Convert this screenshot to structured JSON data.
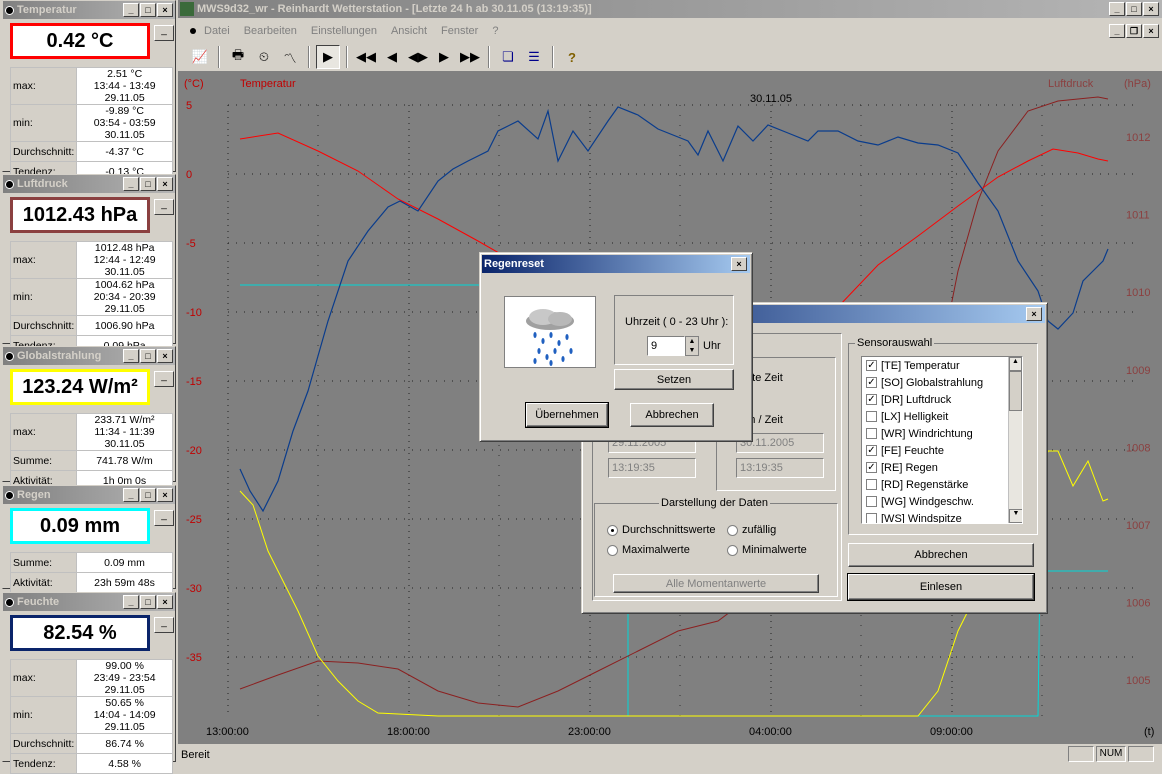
{
  "sensors": [
    {
      "title": "Temperatur",
      "value": "0.42 °C",
      "border": "#ff0000",
      "top": 0,
      "height": 172,
      "rows": [
        [
          "max:",
          "2.51 °C",
          "13:44 - 13:49  29.11.05"
        ],
        [
          "min:",
          "-9.89 °C",
          "03:54 - 03:59  30.11.05"
        ],
        [
          "Durchschnitt:",
          "-4.37 °C",
          ""
        ],
        [
          "Tendenz:",
          "-0.13 °C",
          ""
        ]
      ]
    },
    {
      "title": "Luftdruck",
      "value": "1012.43 hPa",
      "border": "#8b4040",
      "top": 174,
      "height": 170,
      "rows": [
        [
          "max:",
          "1012.48 hPa",
          "12:44 - 12:49  30.11.05"
        ],
        [
          "min:",
          "1004.62 hPa",
          "20:34 - 20:39  29.11.05"
        ],
        [
          "Durchschnitt:",
          "1006.90 hPa",
          ""
        ],
        [
          "Tendenz:",
          "0.09 hPa",
          ""
        ]
      ]
    },
    {
      "title": "Globalstrahlung",
      "value": "123.24 W/m²",
      "border": "#ffff00",
      "top": 346,
      "height": 136,
      "rows": [
        [
          "max:",
          "233.71 W/m²",
          "11:34 - 11:39  30.11.05"
        ],
        [
          "Summe:",
          "741.78 W/m",
          ""
        ],
        [
          "Aktivität:",
          "1h 0m 0s",
          ""
        ]
      ]
    },
    {
      "title": "Regen",
      "value": "0.09 mm",
      "border": "#00ffff",
      "top": 485,
      "height": 104,
      "rows": [
        [
          "Summe:",
          "0.09 mm",
          ""
        ],
        [
          "Aktivität:",
          "23h 59m 48s",
          ""
        ]
      ]
    },
    {
      "title": "Feuchte",
      "value": "82.54 %",
      "border": "#0a246a",
      "top": 592,
      "height": 170,
      "rows": [
        [
          "max:",
          "99.00 %",
          "23:49 - 23:54  29.11.05"
        ],
        [
          "min:",
          "50.65 %",
          "14:04 - 14:09  29.11.05"
        ],
        [
          "Durchschnitt:",
          "86.74 %",
          ""
        ],
        [
          "Tendenz:",
          "4.58 %",
          ""
        ]
      ]
    }
  ],
  "main": {
    "title": "MWS9d32_wr - Reinhardt Wetterstation - [Letzte 24 h ab 30.11.05 (13:19:35)]",
    "menu": [
      "Datei",
      "Bearbeiten",
      "Einstellungen",
      "Ansicht",
      "Fenster",
      "?"
    ]
  },
  "chart": {
    "left_unit": "(°C)",
    "left_label": "Temperatur",
    "right_unit": "(hPa)",
    "right_label": "Luftdruck",
    "date_label": "30.11.05",
    "x_unit": "(t)",
    "y_ticks": [
      "5",
      "0",
      "-5",
      "-10",
      "-15",
      "-20",
      "-25",
      "-30",
      "-35"
    ],
    "r_ticks": [
      "1012",
      "1011",
      "1010",
      "1009",
      "1008",
      "1007",
      "1006",
      "1005"
    ],
    "x_ticks": [
      "13:00:00",
      "18:00:00",
      "23:00:00",
      "04:00:00",
      "09:00:00"
    ]
  },
  "status": {
    "text": "Bereit",
    "num": "NUM"
  },
  "regen_dialog": {
    "title": "Regenreset",
    "time_label": "Uhrzeit ( 0 - 23 Uhr ):",
    "hour_value": "9",
    "hour_unit": "Uhr",
    "set_button": "Setzen",
    "ok_button": "Übernehmen",
    "cancel_button": "Abbrechen"
  },
  "data_dialog": {
    "latest_time": "ktuellste Zeit",
    "date_time": "Datum / Zeit",
    "date_from": "29.11.2005",
    "time_from": "13:19:35",
    "date_to": "30.11.2005",
    "time_to": "13:19:35",
    "display_group": "Darstellung der Daten",
    "radios": [
      "Durchschnittswerte",
      "zufällig",
      "Maximalwerte",
      "Minimalwerte"
    ],
    "moment_button": "Alle Momentanwerte",
    "sensor_group": "Sensorauswahl",
    "sensors": [
      {
        "label": "[TE] Temperatur",
        "checked": true
      },
      {
        "label": "[SO] Globalstrahlung",
        "checked": true
      },
      {
        "label": "[DR] Luftdruck",
        "checked": true
      },
      {
        "label": "[LX] Helligkeit",
        "checked": false
      },
      {
        "label": "[WR] Windrichtung",
        "checked": false
      },
      {
        "label": "[FE] Feuchte",
        "checked": true
      },
      {
        "label": "[RE] Regen",
        "checked": true
      },
      {
        "label": "[RD] Regenstärke",
        "checked": false
      },
      {
        "label": "[WG] Windgeschw.",
        "checked": false
      },
      {
        "label": "[WS] Windspitze",
        "checked": false
      }
    ],
    "cancel_button": "Abbrechen",
    "read_button": "Einlesen"
  }
}
